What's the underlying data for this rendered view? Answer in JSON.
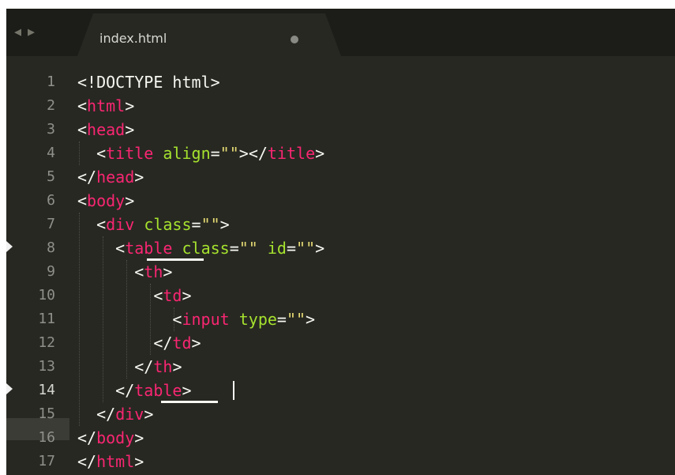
{
  "tab": {
    "filename": "index.html",
    "nav_back_icon": "◀",
    "nav_forward_icon": "▶",
    "modified_indicator": "dot-icon"
  },
  "editor": {
    "theme_colors": {
      "background": "#272822",
      "tag": "#f92672",
      "attribute": "#a6e22e",
      "string": "#e6db74",
      "text": "#f8f8f2",
      "line_number": "#8f908a"
    },
    "active_line": 14,
    "lines": [
      {
        "number": "1",
        "text": "<!DOCTYPE html>"
      },
      {
        "number": "2",
        "text": "<html>"
      },
      {
        "number": "3",
        "text": "<head>"
      },
      {
        "number": "4",
        "text": "  <title align=\"\"></title>"
      },
      {
        "number": "5",
        "text": "</head>"
      },
      {
        "number": "6",
        "text": "<body>"
      },
      {
        "number": "7",
        "text": "  <div class=\"\">"
      },
      {
        "number": "8",
        "text": "    <table class=\"\" id=\"\">"
      },
      {
        "number": "9",
        "text": "      <th>"
      },
      {
        "number": "10",
        "text": "        <td>"
      },
      {
        "number": "11",
        "text": "          <input type=\"\">"
      },
      {
        "number": "12",
        "text": "        </td>"
      },
      {
        "number": "13",
        "text": "      </th>"
      },
      {
        "number": "14",
        "text": "    </table>"
      },
      {
        "number": "15",
        "text": "  </div>"
      },
      {
        "number": "16",
        "text": "</body>"
      },
      {
        "number": "17",
        "text": "</html>"
      }
    ]
  }
}
